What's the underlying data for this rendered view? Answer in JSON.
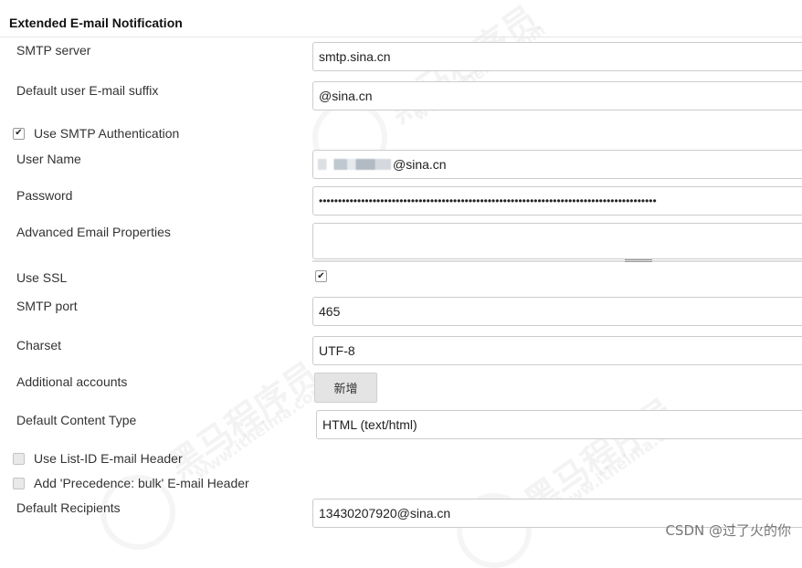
{
  "section": {
    "title": "Extended E-mail Notification"
  },
  "fields": {
    "smtp_server": {
      "label": "SMTP server",
      "value": "smtp.sina.cn"
    },
    "email_suffix": {
      "label": "Default user E-mail suffix",
      "value": "@sina.cn"
    },
    "use_smtp_auth": {
      "label": "Use SMTP Authentication",
      "checked": true
    },
    "user_name": {
      "label": "User Name",
      "value": "@sina.cn"
    },
    "password": {
      "label": "Password",
      "value": "••••••••••••••••••••••••••••••••••••••••••••••••••••••••••••••••••••••••••••••••••••••••"
    },
    "advanced_props": {
      "label": "Advanced Email Properties",
      "value": ""
    },
    "use_ssl": {
      "label": "Use SSL",
      "checked": true
    },
    "smtp_port": {
      "label": "SMTP port",
      "value": "465"
    },
    "charset": {
      "label": "Charset",
      "value": "UTF-8"
    },
    "additional_accounts": {
      "label": "Additional accounts",
      "button_label": "新增"
    },
    "content_type": {
      "label": "Default Content Type",
      "value": "HTML (text/html)"
    },
    "list_id_header": {
      "label": "Use List-ID E-mail Header",
      "checked": false
    },
    "precedence_header": {
      "label": "Add 'Precedence: bulk' E-mail Header",
      "checked": false
    },
    "default_recipients": {
      "label": "Default Recipients",
      "value": "13430207920@sina.cn"
    }
  },
  "watermarks": {
    "brand": "黑马程序员",
    "site": "www.itheima.com"
  },
  "footer": {
    "credit": "CSDN @过了火的你"
  },
  "colors": {
    "border": "#cccccc",
    "button_bg": "#e4e4e4",
    "text": "#333333"
  }
}
